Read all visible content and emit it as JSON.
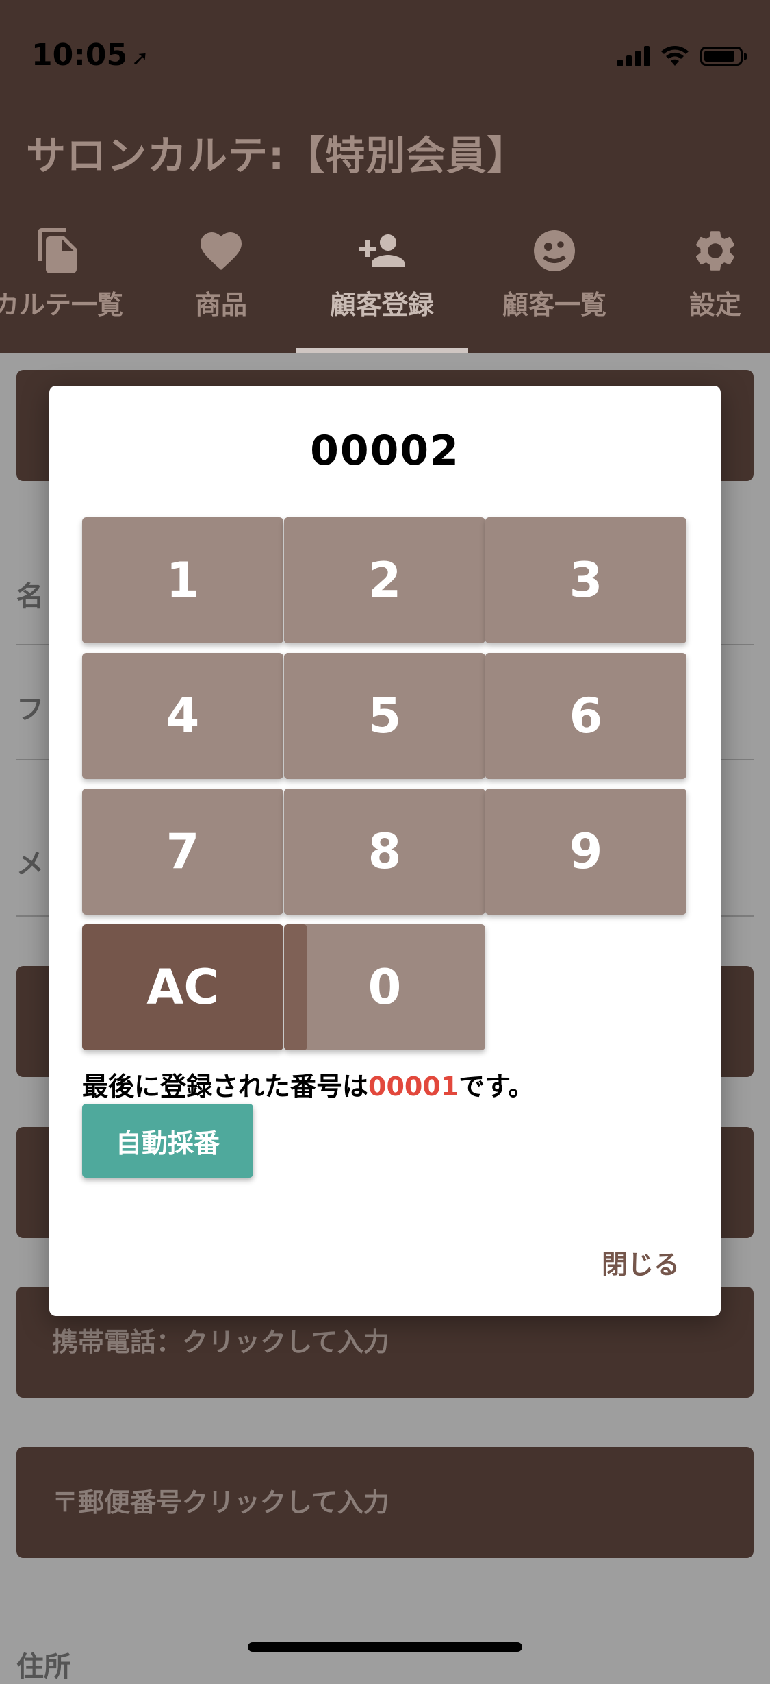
{
  "status_bar": {
    "time": "10:05",
    "location_glyph": "➚"
  },
  "app": {
    "title": "サロンカルテ:【特別会員】"
  },
  "tabs": [
    {
      "label": "カルテ一覧",
      "icon": "document-copy-icon"
    },
    {
      "label": "商品",
      "icon": "heart-icon"
    },
    {
      "label": "顧客登録",
      "icon": "person-add-icon",
      "active": true
    },
    {
      "label": "顧客一覧",
      "icon": "face-icon"
    },
    {
      "label": "設定",
      "icon": "gear-icon"
    }
  ],
  "background_form": {
    "labels": [
      "名",
      "フ",
      "メ",
      "住所"
    ],
    "mobile_placeholder": "携帯電話：クリックして入力",
    "postal_placeholder": "〒郵便番号クリックして入力"
  },
  "dialog": {
    "display_value": "00002",
    "keys": [
      "1",
      "2",
      "3",
      "4",
      "5",
      "6",
      "7",
      "8",
      "9",
      "AC",
      "0"
    ],
    "info_prefix": "最後に登録された番号は",
    "info_number": "00001",
    "info_suffix": "です。",
    "auto_number_label": "自動採番",
    "close_label": "閉じる"
  },
  "colors": {
    "header_bg": "#45332d",
    "key_bg": "#9d8981",
    "ac_key_bg": "#75564b",
    "auto_btn_bg": "#4fa99c",
    "highlight_number": "#e2483c"
  }
}
